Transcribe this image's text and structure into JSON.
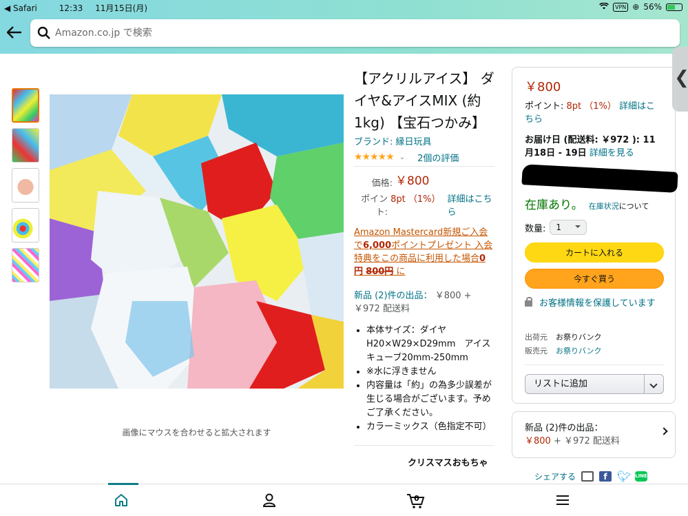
{
  "status_bar": {
    "app": "Safari",
    "time": "12:33",
    "date": "11月15日(月)",
    "vpn": "VPN",
    "battery": "56%",
    "battery_level": 0.56
  },
  "search": {
    "placeholder": "Amazon.co.jp で検索"
  },
  "gallery": {
    "zoom_hint": "画像にマウスを合わせると拡大されます"
  },
  "product": {
    "title": "【アクリルアイス】 ダイヤ&アイスMIX (約1kg) 【宝石つかみ】",
    "brand": "ブランド: 縁日玩具",
    "rating": 4.5,
    "stars": "★★★★★",
    "rating_count": "2個の評価",
    "price_label": "価格:",
    "price": "￥800",
    "points_label": "ポイント:",
    "points": "8pt （1%）",
    "points_link": "詳細はこちら",
    "promo_a": "Amazon Mastercard新規ご入会で",
    "promo_points": "6,000",
    "promo_b": "ポイントプレゼント 入会特典をこの商品に利用した場合",
    "promo_zero": "0円",
    "promo_strike": "800円",
    "promo_c": " に",
    "new_offers_link": "新品 (2)件の出品：",
    "new_offers_price": "￥800 + ￥972 配送料",
    "bullets": [
      "本体サイズ：ダイヤH20×W29×D29mm　アイスキューブ20mm-250mm",
      "※水に浮きません",
      "内容量は「約」の為多少誤差が生じる場合がございます。予めご了承ください。",
      "カラーミックス（色指定不可）"
    ],
    "related_title": "クリスマスおもちゃ"
  },
  "buy_box": {
    "price": "￥800",
    "points_label": "ポイント: ",
    "points": "8pt （1%）",
    "points_link": "詳細はこちら",
    "delivery": "お届け日 (配送料: ￥972 ): 11月18日 - 19日",
    "delivery_link": "詳細を見る",
    "stock": "在庫あり。",
    "stock_link": "在庫状況",
    "stock_tail": "について",
    "qty_label": "数量:",
    "qty_value": "1",
    "add_to_cart": "カートに入れる",
    "buy_now": "今すぐ買う",
    "secure": "お客様情報を保護しています",
    "ships_from_label": "出荷元",
    "ships_from": "お祭りバンク",
    "sold_by_label": "販売元",
    "sold_by": "お祭りバンク",
    "add_to_list": "リストに追加"
  },
  "new_offers_box": {
    "label": "新品 (2)件の出品：",
    "price": "￥800",
    "shipping": " + ￥972 配送料"
  },
  "share": {
    "label": "シェアする"
  },
  "bottom_nav": {
    "cart_count": "0"
  },
  "colors": {
    "accent": "#0e7c86",
    "price": "#b12704",
    "link": "#007185",
    "cart_button": "#ffd814",
    "buy_button": "#ffa41c"
  }
}
